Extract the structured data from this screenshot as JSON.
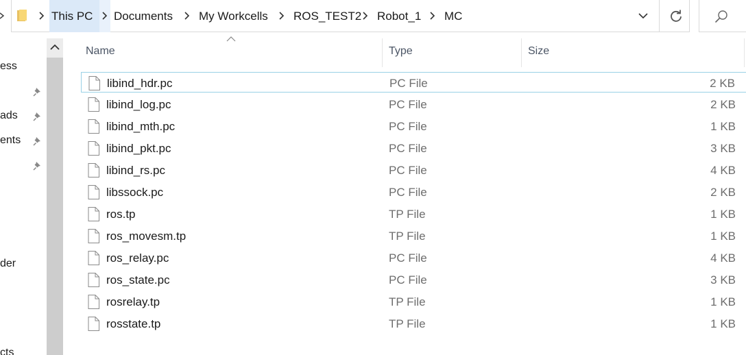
{
  "address_bar": {
    "path": [
      "This PC",
      "Documents",
      "My Workcells",
      "ROS_TEST2",
      "Robot_1",
      "MC"
    ]
  },
  "nav_pane": {
    "items": [
      {
        "label": "ess",
        "pinned": false
      },
      {
        "label": "",
        "pinned": true
      },
      {
        "label": "ads",
        "pinned": true
      },
      {
        "label": "ents",
        "pinned": true
      },
      {
        "label": "",
        "pinned": true
      },
      {
        "label": "der",
        "pinned": false
      },
      {
        "label": "cts",
        "pinned": false
      }
    ]
  },
  "columns": {
    "name": "Name",
    "type": "Type",
    "size": "Size"
  },
  "files": [
    {
      "name": "libind_hdr.pc",
      "type": "PC File",
      "size": "2 KB"
    },
    {
      "name": "libind_log.pc",
      "type": "PC File",
      "size": "2 KB"
    },
    {
      "name": "libind_mth.pc",
      "type": "PC File",
      "size": "1 KB"
    },
    {
      "name": "libind_pkt.pc",
      "type": "PC File",
      "size": "3 KB"
    },
    {
      "name": "libind_rs.pc",
      "type": "PC File",
      "size": "4 KB"
    },
    {
      "name": "libssock.pc",
      "type": "PC File",
      "size": "2 KB"
    },
    {
      "name": "ros.tp",
      "type": "TP File",
      "size": "1 KB"
    },
    {
      "name": "ros_movesm.tp",
      "type": "TP File",
      "size": "1 KB"
    },
    {
      "name": "ros_relay.pc",
      "type": "PC File",
      "size": "4 KB"
    },
    {
      "name": "ros_state.pc",
      "type": "PC File",
      "size": "3 KB"
    },
    {
      "name": "rosrelay.tp",
      "type": "TP File",
      "size": "1 KB"
    },
    {
      "name": "rosstate.tp",
      "type": "TP File",
      "size": "1 KB"
    }
  ],
  "colors": {
    "selected_crumb": "#dbe9f8",
    "focus_border": "#99d1e6",
    "secondary_text": "#6d6d6d"
  }
}
